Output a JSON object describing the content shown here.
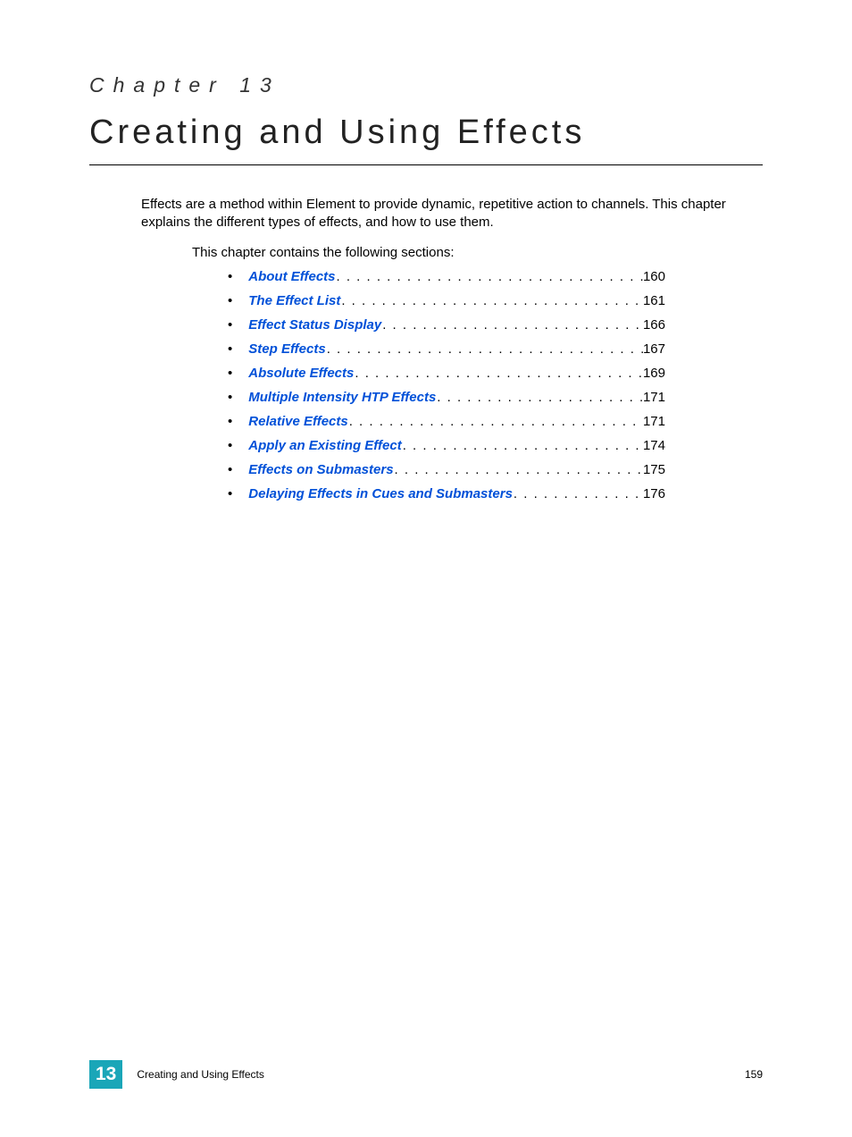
{
  "chapter": {
    "label": "Chapter 13",
    "title": "Creating and Using Effects",
    "intro": "Effects are a method within Element to provide dynamic, repetitive action to channels. This chapter explains the different types of effects, and how to use them.",
    "sections_intro": "This chapter contains the following sections:"
  },
  "toc": [
    {
      "title": "About Effects",
      "page": "160"
    },
    {
      "title": "The Effect List",
      "page": "161"
    },
    {
      "title": "Effect Status Display",
      "page": "166"
    },
    {
      "title": "Step Effects",
      "page": "167"
    },
    {
      "title": "Absolute Effects",
      "page": "169"
    },
    {
      "title": "Multiple Intensity HTP Effects",
      "page": "171"
    },
    {
      "title": "Relative Effects",
      "page": "171"
    },
    {
      "title": "Apply an Existing Effect",
      "page": "174"
    },
    {
      "title": "Effects on Submasters",
      "page": "175"
    },
    {
      "title": "Delaying Effects in Cues and Submasters",
      "page": "176"
    }
  ],
  "footer": {
    "chapter_number": "13",
    "title": "Creating and Using Effects",
    "page": "159"
  }
}
